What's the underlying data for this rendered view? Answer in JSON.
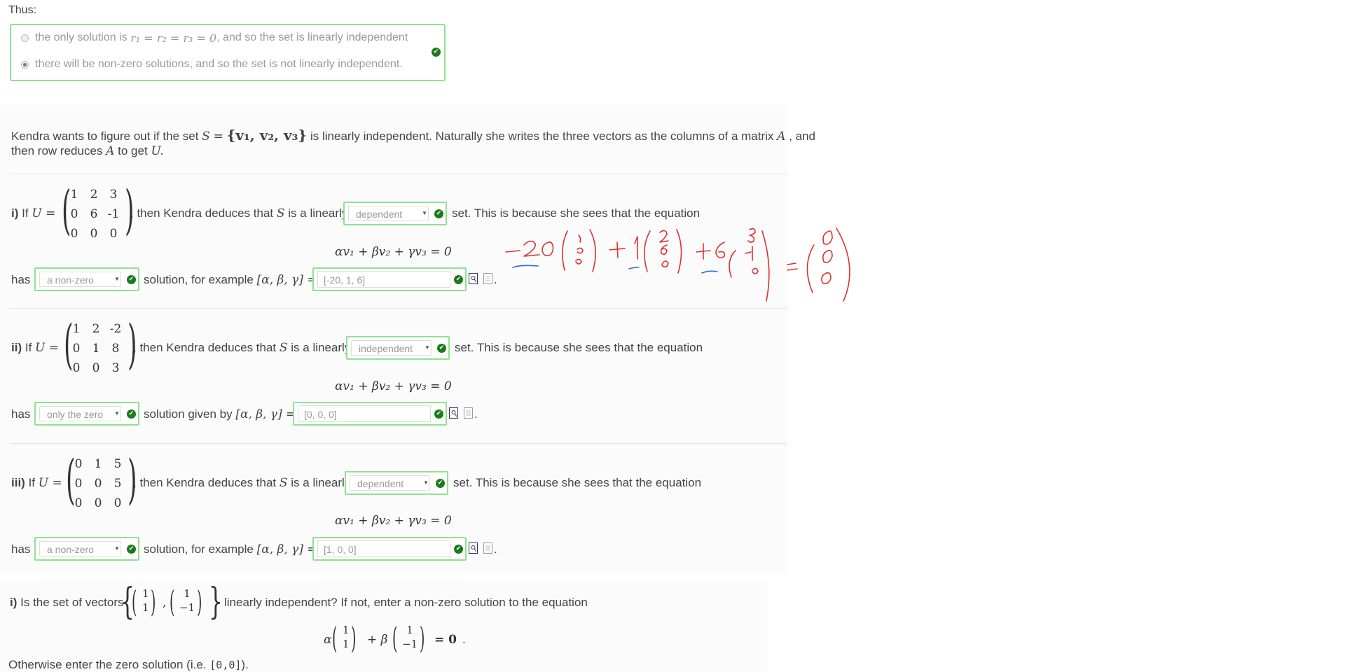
{
  "intro": {
    "thus": "Thus:"
  },
  "radio_group": {
    "option1": {
      "text_before": "the only solution is",
      "math": "r₁ = r₂ = r₃ = 0",
      "text_after": ", and so the set is linearly independent",
      "selected": false
    },
    "option2": {
      "text": "there will be non-zero solutions, and so the set is not linearly independent.",
      "selected": true
    }
  },
  "kendra": {
    "line1_a": "Kendra wants to figure out if the set",
    "set_S": "S",
    "set_eq": "=",
    "set_brace": "{v₁, v₂, v₃}",
    "line1_b": "is linearly independent. Naturally she writes the three vectors as the columns of a matrix",
    "matrix_A": "A",
    "line1_c": ", and",
    "line2_a": "then row reduces",
    "line2_b": "to get",
    "line2_U": "U."
  },
  "equation": "αv₁ + βv₂ + γv₃ = 0",
  "parts": [
    {
      "label": "i)",
      "if_text": "If",
      "U": "U =",
      "matrix": [
        [
          "1",
          "2",
          "3"
        ],
        [
          "0",
          "6",
          "-1"
        ],
        [
          "0",
          "0",
          "0"
        ]
      ],
      "deduce": ", then Kendra deduces that",
      "S": "S",
      "linearly": "is a linearly",
      "dropdown1": "dependent",
      "after": "set. This is because she sees that the equation",
      "has": "has",
      "dropdown2": "a non-zero",
      "solution_text": "solution, for example",
      "vec": "[α, β, γ] =",
      "answer": "[-20, 1, 6]"
    },
    {
      "label": "ii)",
      "if_text": "If",
      "U": "U =",
      "matrix": [
        [
          "1",
          "2",
          "-2"
        ],
        [
          "0",
          "1",
          "8"
        ],
        [
          "0",
          "0",
          "3"
        ]
      ],
      "deduce": ", then Kendra deduces that",
      "S": "S",
      "linearly": "is a linearly",
      "dropdown1": "independent",
      "after": "set. This is because she sees that the equation",
      "has": "has",
      "dropdown2": "only the zero",
      "solution_text": "solution given by",
      "vec": "[α, β, γ] =",
      "answer": "[0, 0, 0]"
    },
    {
      "label": "iii)",
      "if_text": "If",
      "U": "U =",
      "matrix": [
        [
          "0",
          "1",
          "5"
        ],
        [
          "0",
          "0",
          "5"
        ],
        [
          "0",
          "0",
          "0"
        ]
      ],
      "deduce": ", then Kendra deduces that",
      "S": "S",
      "linearly": "is a linearly",
      "dropdown1": "dependent",
      "after": "set. This is because she sees that the equation",
      "has": "has",
      "dropdown2": "a non-zero",
      "solution_text": "solution, for example",
      "vec": "[α, β, γ] =",
      "answer": "[1, 0, 0]"
    }
  ],
  "period": ".",
  "last": {
    "label": "i)",
    "question_a": "Is the set of vectors",
    "v1": [
      "1",
      "1"
    ],
    "v2": [
      "1",
      "−1"
    ],
    "question_b": "linearly independent? If not, enter a non-zero solution to the equation",
    "alpha": "α",
    "plus_beta": "+ β",
    "eq_zero": "= 0",
    "eq_period": ".",
    "otherwise": "Otherwise enter the zero solution (i.e.",
    "zero_code": "[0,0]",
    "otherwise_end": ")."
  },
  "colors": {
    "accent_green": "#8fe38f",
    "check_green": "#1c7a1c",
    "ink_red": "#e03030",
    "ink_blue": "#2a6fd6"
  }
}
